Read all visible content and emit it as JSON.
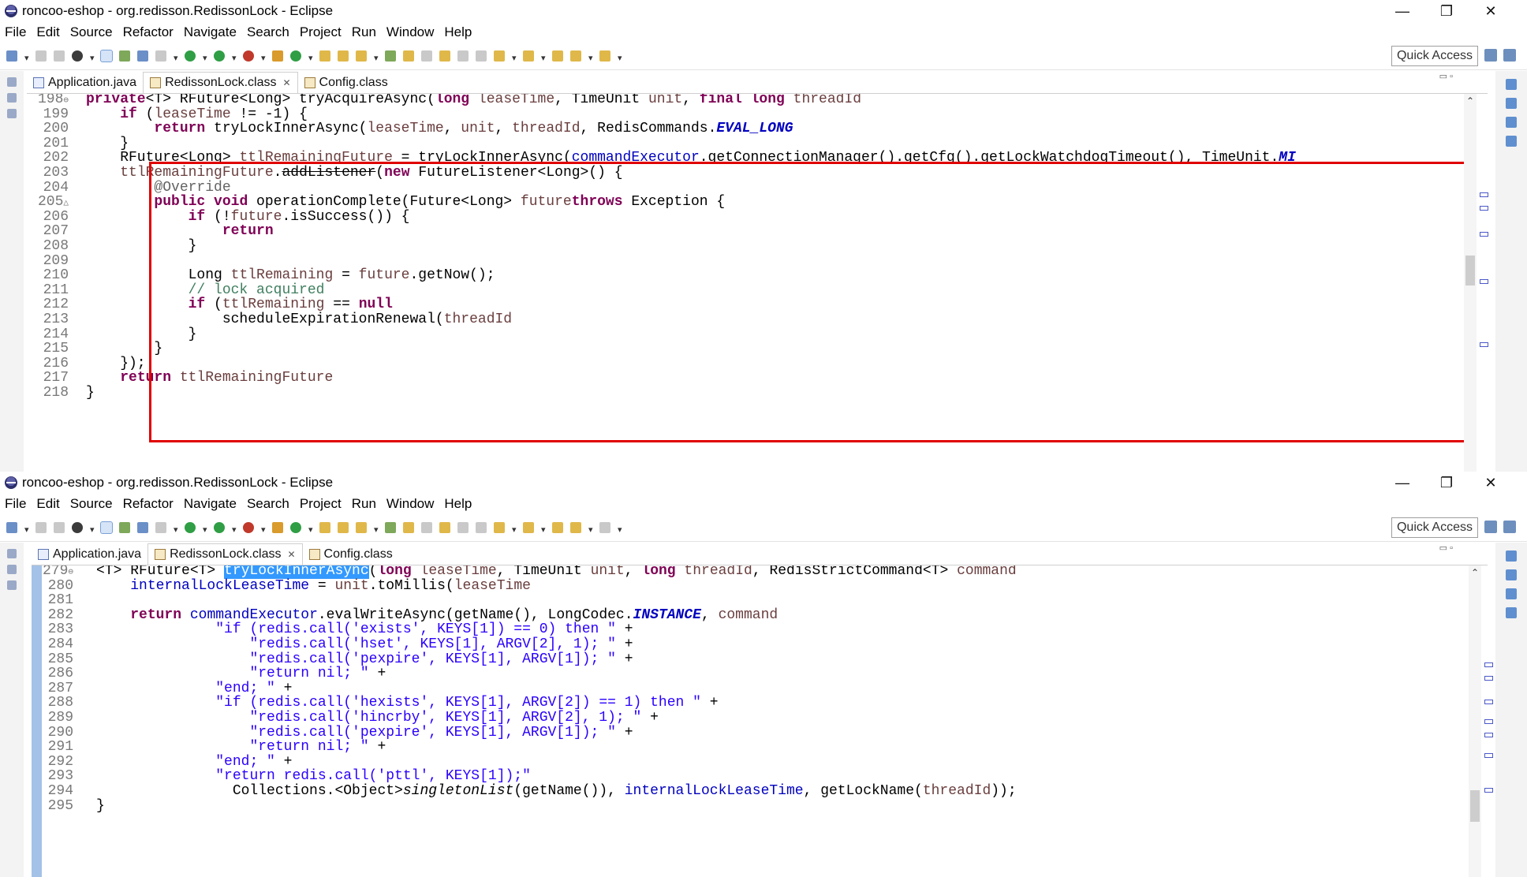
{
  "window1": {
    "title": "roncoo-eshop - org.redisson.RedissonLock - Eclipse",
    "menu": [
      "File",
      "Edit",
      "Source",
      "Refactor",
      "Navigate",
      "Search",
      "Project",
      "Run",
      "Window",
      "Help"
    ],
    "quick_access": "Quick Access",
    "tabs": [
      {
        "label": "Application.java",
        "active": false,
        "closable": false
      },
      {
        "label": "RedissonLock.class",
        "active": true,
        "closable": true
      },
      {
        "label": "Config.class",
        "active": false,
        "closable": false
      }
    ],
    "lines": [
      {
        "n": "198",
        "mark": "⊖",
        "code": [
          [
            "kw",
            "private"
          ],
          [
            "",
            "<T> RFuture<Long> tryAcquireAsync("
          ],
          [
            "kw",
            "long"
          ],
          [
            "",
            " "
          ],
          [
            "var",
            "leaseTime"
          ],
          [
            "",
            ", TimeUnit "
          ],
          [
            "var",
            "unit"
          ],
          [
            "",
            ", "
          ],
          [
            "kw",
            "final long"
          ],
          [
            "",
            " "
          ],
          [
            "var",
            "threadId"
          ],
          [
            ") {"
          ]
        ]
      },
      {
        "n": "199",
        "code": [
          [
            "",
            "    "
          ],
          [
            "kw",
            "if"
          ],
          [
            "",
            " ("
          ],
          [
            "var",
            "leaseTime"
          ],
          [
            "",
            " != -1) {"
          ]
        ]
      },
      {
        "n": "200",
        "code": [
          [
            "",
            "        "
          ],
          [
            "kw",
            "return"
          ],
          [
            "",
            " tryLockInnerAsync("
          ],
          [
            "var",
            "leaseTime"
          ],
          [
            "",
            ", "
          ],
          [
            "var",
            "unit"
          ],
          [
            "",
            ", "
          ],
          [
            "var",
            "threadId"
          ],
          [
            "",
            ", RedisCommands."
          ],
          [
            "sfld",
            "EVAL_LONG"
          ],
          [
            ");"
          ]
        ]
      },
      {
        "n": "201",
        "code": [
          [
            "",
            "    }"
          ]
        ]
      },
      {
        "n": "202",
        "code": [
          [
            "",
            "    RFuture<Long> "
          ],
          [
            "var",
            "ttlRemainingFuture"
          ],
          [
            "",
            " = tryLockInnerAsync("
          ],
          [
            "fld",
            "commandExecutor"
          ],
          [
            "",
            ".getConnectionManager().getCfg().getLockWatchdogTimeout(), TimeUnit."
          ],
          [
            "sfld",
            "MI"
          ]
        ]
      },
      {
        "n": "203",
        "code": [
          [
            "",
            "    "
          ],
          [
            "var",
            "ttlRemainingFuture"
          ],
          [
            "",
            "."
          ],
          [
            "strike",
            "addListener"
          ],
          [
            "",
            "("
          ],
          [
            "kw",
            "new"
          ],
          [
            "",
            " FutureListener<Long>() {"
          ]
        ]
      },
      {
        "n": "204",
        "code": [
          [
            "",
            "        "
          ],
          [
            "ann",
            "@Override"
          ]
        ]
      },
      {
        "n": "205",
        "mark": "△",
        "code": [
          [
            "",
            "        "
          ],
          [
            "kw",
            "public void"
          ],
          [
            "",
            " operationComplete(Future<Long> "
          ],
          [
            "var",
            "future"
          ],
          [
            ") "
          ],
          [
            "kw",
            "throws"
          ],
          [
            "",
            " Exception {"
          ]
        ]
      },
      {
        "n": "206",
        "code": [
          [
            "",
            "            "
          ],
          [
            "kw",
            "if"
          ],
          [
            "",
            " (!"
          ],
          [
            "var",
            "future"
          ],
          [
            "",
            ".isSuccess()) {"
          ]
        ]
      },
      {
        "n": "207",
        "code": [
          [
            "",
            "                "
          ],
          [
            "kw",
            "return"
          ],
          [
            ";"
          ]
        ]
      },
      {
        "n": "208",
        "code": [
          [
            "",
            "            }"
          ]
        ]
      },
      {
        "n": "209",
        "code": [
          [
            "",
            ""
          ]
        ]
      },
      {
        "n": "210",
        "code": [
          [
            "",
            "            Long "
          ],
          [
            "var",
            "ttlRemaining"
          ],
          [
            "",
            " = "
          ],
          [
            "var",
            "future"
          ],
          [
            "",
            ".getNow();"
          ]
        ]
      },
      {
        "n": "211",
        "code": [
          [
            "",
            "            "
          ],
          [
            "cmt",
            "// lock acquired"
          ]
        ]
      },
      {
        "n": "212",
        "code": [
          [
            "",
            "            "
          ],
          [
            "kw",
            "if"
          ],
          [
            "",
            " ("
          ],
          [
            "var",
            "ttlRemaining"
          ],
          [
            "",
            " == "
          ],
          [
            "kw",
            "null"
          ],
          [
            ") {"
          ]
        ]
      },
      {
        "n": "213",
        "code": [
          [
            "",
            "                scheduleExpirationRenewal("
          ],
          [
            "var",
            "threadId"
          ],
          [
            ");"
          ]
        ]
      },
      {
        "n": "214",
        "code": [
          [
            "",
            "            }"
          ]
        ]
      },
      {
        "n": "215",
        "code": [
          [
            "",
            "        }"
          ]
        ]
      },
      {
        "n": "216",
        "code": [
          [
            "",
            "    });"
          ]
        ]
      },
      {
        "n": "217",
        "code": [
          [
            "",
            "    "
          ],
          [
            "kw",
            "return"
          ],
          [
            "",
            " "
          ],
          [
            "var",
            "ttlRemainingFuture"
          ],
          [
            ";"
          ]
        ]
      },
      {
        "n": "218",
        "code": [
          [
            "",
            "}"
          ]
        ]
      }
    ]
  },
  "window2": {
    "title": "roncoo-eshop - org.redisson.RedissonLock - Eclipse",
    "menu": [
      "File",
      "Edit",
      "Source",
      "Refactor",
      "Navigate",
      "Search",
      "Project",
      "Run",
      "Window",
      "Help"
    ],
    "quick_access": "Quick Access",
    "tabs": [
      {
        "label": "Application.java",
        "active": false,
        "closable": false
      },
      {
        "label": "RedissonLock.class",
        "active": true,
        "closable": true
      },
      {
        "label": "Config.class",
        "active": false,
        "closable": false
      }
    ],
    "lines": [
      {
        "n": "279",
        "mark": "⊖",
        "code": [
          [
            "",
            "<T> RFuture<T> "
          ],
          [
            "hl",
            "tryLockInnerAsync"
          ],
          [
            "",
            "("
          ],
          [
            "kw",
            "long"
          ],
          [
            "",
            " "
          ],
          [
            "var",
            "leaseTime"
          ],
          [
            "",
            ", TimeUnit "
          ],
          [
            "var",
            "unit"
          ],
          [
            "",
            ", "
          ],
          [
            "kw",
            "long"
          ],
          [
            "",
            " "
          ],
          [
            "var",
            "threadId"
          ],
          [
            "",
            ", RedisStrictCommand<T> "
          ],
          [
            "var",
            "command"
          ],
          [
            ") {"
          ]
        ]
      },
      {
        "n": "280",
        "code": [
          [
            "",
            "    "
          ],
          [
            "fld",
            "internalLockLeaseTime"
          ],
          [
            "",
            " = "
          ],
          [
            "var",
            "unit"
          ],
          [
            "",
            ".toMillis("
          ],
          [
            "var",
            "leaseTime"
          ],
          [
            ");"
          ]
        ]
      },
      {
        "n": "281",
        "code": [
          [
            "",
            ""
          ]
        ]
      },
      {
        "n": "282",
        "code": [
          [
            "",
            "    "
          ],
          [
            "kw",
            "return"
          ],
          [
            "",
            " "
          ],
          [
            "fld",
            "commandExecutor"
          ],
          [
            "",
            ".evalWriteAsync(getName(), LongCodec."
          ],
          [
            "sfld",
            "INSTANCE"
          ],
          [
            "",
            ", "
          ],
          [
            "var",
            "command"
          ],
          [
            ","
          ]
        ]
      },
      {
        "n": "283",
        "code": [
          [
            "",
            "              "
          ],
          [
            "str",
            "\"if (redis.call('exists', KEYS[1]) == 0) then \""
          ],
          [
            "",
            " +"
          ]
        ]
      },
      {
        "n": "284",
        "code": [
          [
            "",
            "                  "
          ],
          [
            "str",
            "\"redis.call('hset', KEYS[1], ARGV[2], 1); \""
          ],
          [
            "",
            " +"
          ]
        ]
      },
      {
        "n": "285",
        "code": [
          [
            "",
            "                  "
          ],
          [
            "str",
            "\"redis.call('pexpire', KEYS[1], ARGV[1]); \""
          ],
          [
            "",
            " +"
          ]
        ]
      },
      {
        "n": "286",
        "code": [
          [
            "",
            "                  "
          ],
          [
            "str",
            "\"return nil; \""
          ],
          [
            "",
            " +"
          ]
        ]
      },
      {
        "n": "287",
        "code": [
          [
            "",
            "              "
          ],
          [
            "str",
            "\"end; \""
          ],
          [
            "",
            " +"
          ]
        ]
      },
      {
        "n": "288",
        "code": [
          [
            "",
            "              "
          ],
          [
            "str",
            "\"if (redis.call('hexists', KEYS[1], ARGV[2]) == 1) then \""
          ],
          [
            "",
            " +"
          ]
        ]
      },
      {
        "n": "289",
        "code": [
          [
            "",
            "                  "
          ],
          [
            "str",
            "\"redis.call('hincrby', KEYS[1], ARGV[2], 1); \""
          ],
          [
            "",
            " +"
          ]
        ]
      },
      {
        "n": "290",
        "code": [
          [
            "",
            "                  "
          ],
          [
            "str",
            "\"redis.call('pexpire', KEYS[1], ARGV[1]); \""
          ],
          [
            "",
            " +"
          ]
        ]
      },
      {
        "n": "291",
        "code": [
          [
            "",
            "                  "
          ],
          [
            "str",
            "\"return nil; \""
          ],
          [
            "",
            " +"
          ]
        ]
      },
      {
        "n": "292",
        "code": [
          [
            "",
            "              "
          ],
          [
            "str",
            "\"end; \""
          ],
          [
            "",
            " +"
          ]
        ]
      },
      {
        "n": "293",
        "code": [
          [
            "",
            "              "
          ],
          [
            "str",
            "\"return redis.call('pttl', KEYS[1]);\""
          ],
          [
            ","
          ]
        ]
      },
      {
        "n": "294",
        "code": [
          [
            "",
            "                Collections.<Object>"
          ],
          [
            "smeth",
            "singletonList"
          ],
          [
            "",
            "(getName()), "
          ],
          [
            "fld",
            "internalLockLeaseTime"
          ],
          [
            "",
            ", getLockName("
          ],
          [
            "var",
            "threadId"
          ],
          [
            "",
            "));"
          ]
        ]
      },
      {
        "n": "295",
        "code": [
          [
            "",
            "}"
          ]
        ]
      }
    ]
  }
}
